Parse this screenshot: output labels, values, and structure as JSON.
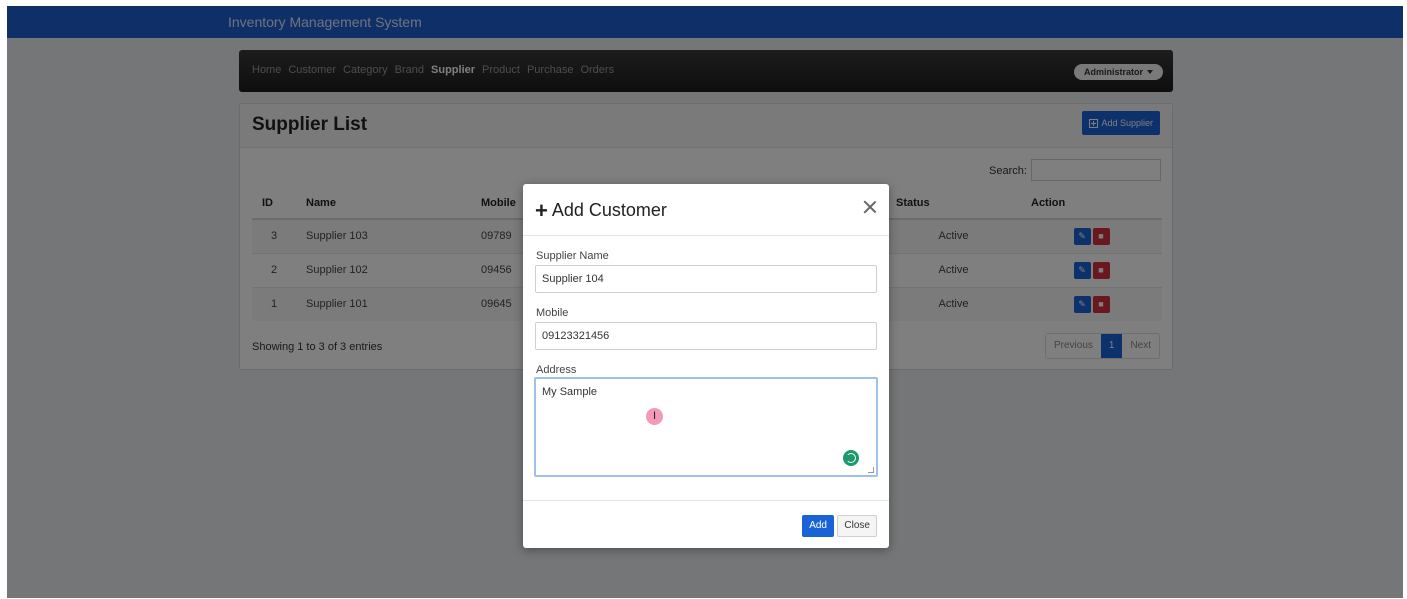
{
  "app": {
    "title": "Inventory Management System"
  },
  "nav": {
    "items": [
      "Home",
      "Customer",
      "Category",
      "Brand",
      "Supplier",
      "Product",
      "Purchase",
      "Orders"
    ],
    "active": "Supplier",
    "user_label": "Administrator"
  },
  "page": {
    "title": "Supplier List",
    "add_button_label": "Add Supplier",
    "search_label": "Search:",
    "search_value": "",
    "columns": [
      "ID",
      "Name",
      "Mobile",
      "Status",
      "Action"
    ],
    "rows": [
      {
        "id": "3",
        "name": "Supplier 103",
        "mobile": "09789",
        "status": "Active"
      },
      {
        "id": "2",
        "name": "Supplier 102",
        "mobile": "09456",
        "status": "Active"
      },
      {
        "id": "1",
        "name": "Supplier 101",
        "mobile": "09645",
        "status": "Active"
      }
    ],
    "entries_info": "Showing 1 to 3 of 3 entries",
    "pagination": {
      "previous": "Previous",
      "current": "1",
      "next": "Next"
    }
  },
  "modal": {
    "title_icon": "+",
    "title": "Add Customer",
    "supplier_name_label": "Supplier Name",
    "supplier_name_value": "Supplier 104",
    "mobile_label": "Mobile",
    "mobile_value": "09123321456",
    "address_label": "Address",
    "address_value": "My Sample",
    "cursor_glyph": "I",
    "add_label": "Add",
    "close_label": "Close"
  },
  "colors": {
    "appbar": "#1f5fd0",
    "primary": "#1a63d6",
    "danger": "#d0303d",
    "focus_border": "#9fc0ea"
  },
  "icons": {
    "add_supplier": "plus-square-icon",
    "edit": "edit-icon",
    "delete": "trash-icon",
    "modal_close": "close-icon",
    "user_menu": "caret-down-icon"
  }
}
